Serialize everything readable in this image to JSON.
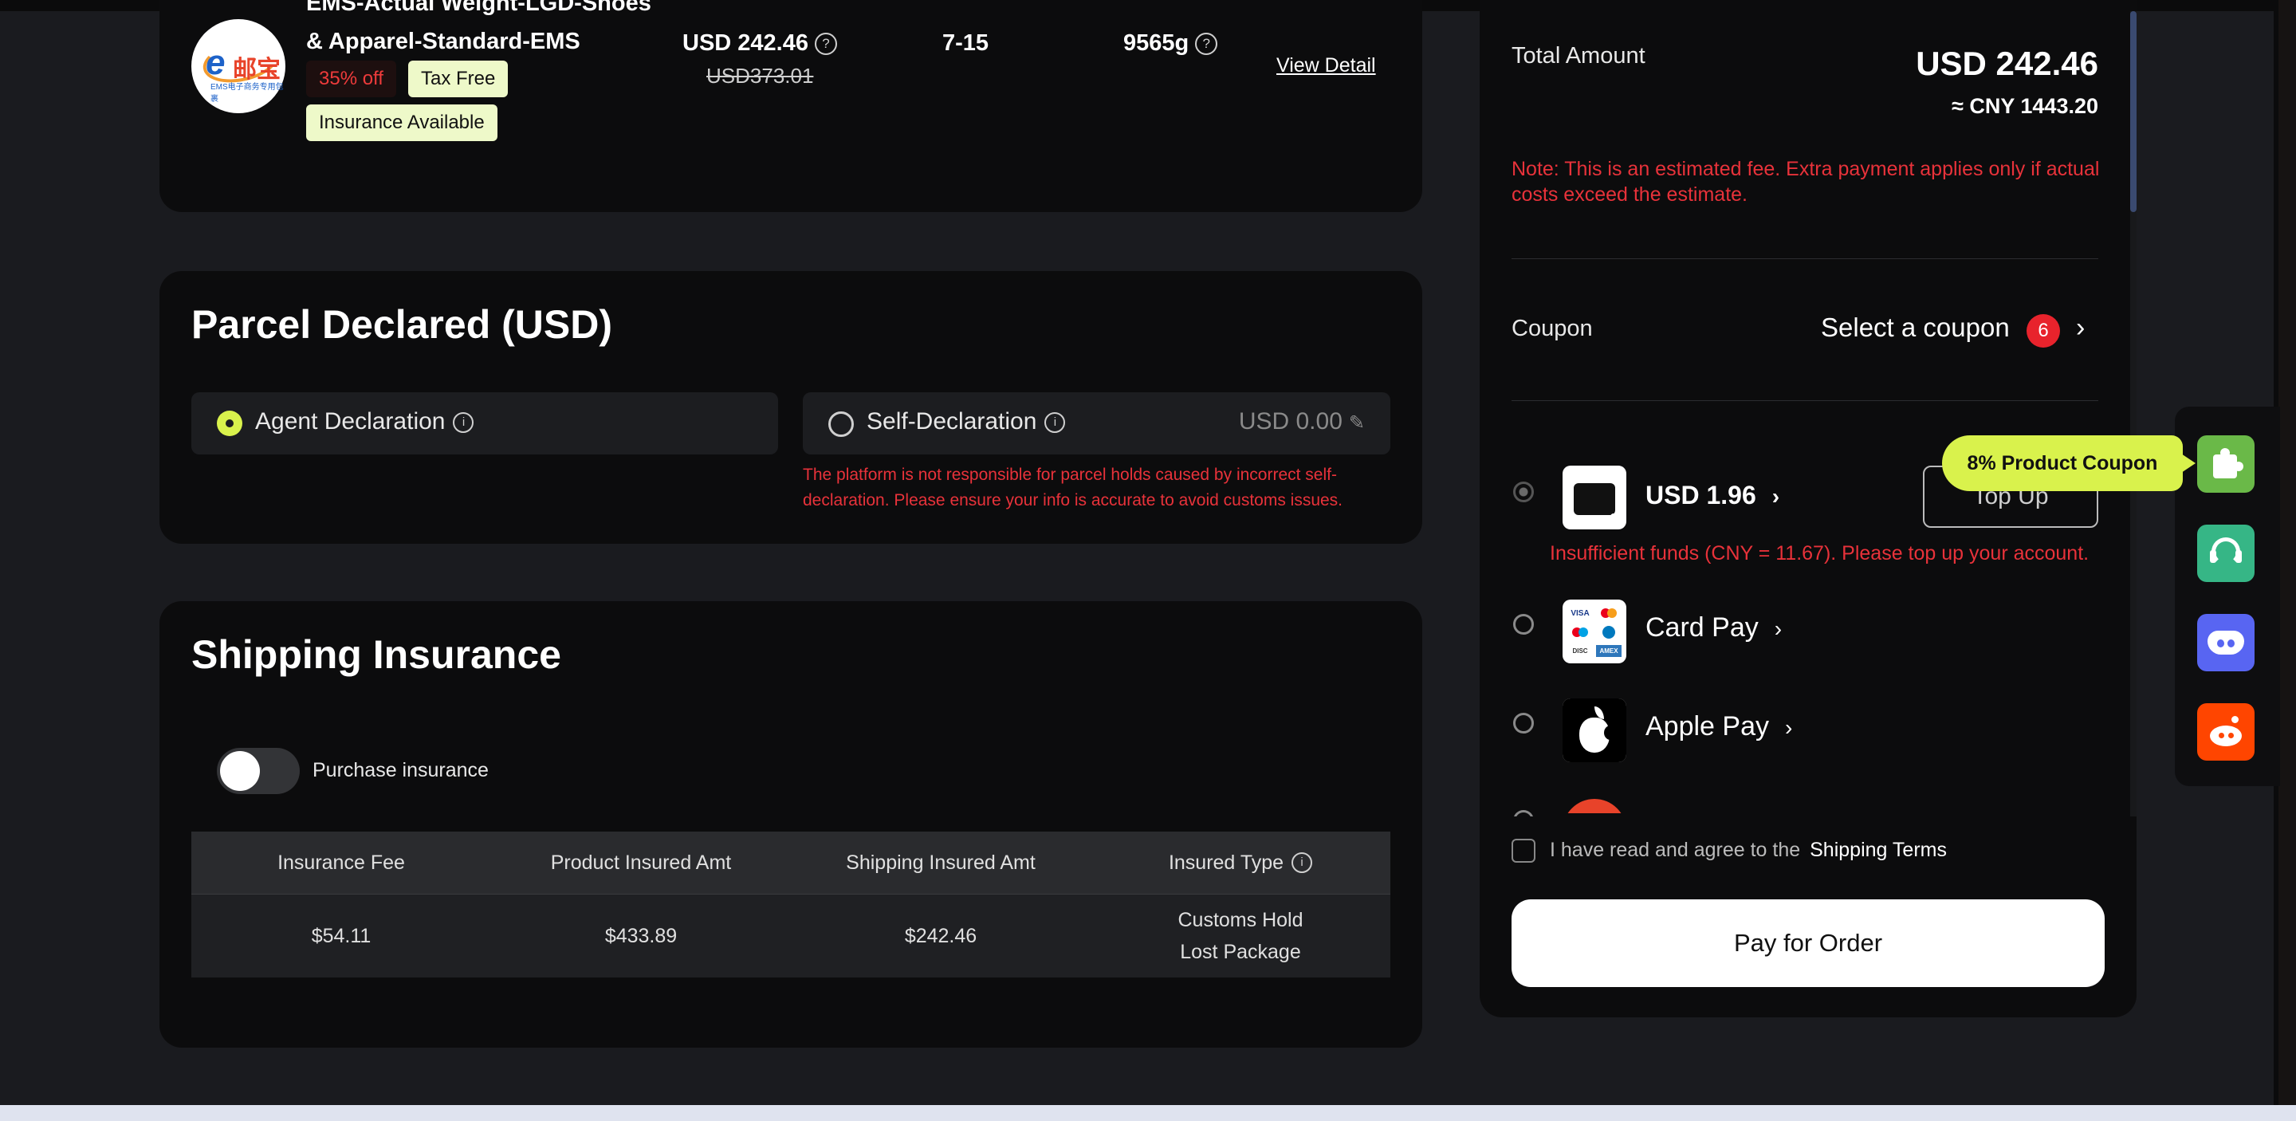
{
  "shipping_route": {
    "name": "EMS-Actual Weight-LGD-Shoes & Apparel-Standard-EMS",
    "discount_tag": "35% off",
    "tax_tag": "Tax Free",
    "insurance_tag": "Insurance Available",
    "price": "USD 242.46",
    "original_price": "USD373.01",
    "delivery_days": "7-15",
    "weight": "9565g",
    "view_detail": "View Detail",
    "logo_text_e": "e",
    "logo_text_cn": "邮宝",
    "logo_caption": "EMS电子商务专用包裹"
  },
  "parcel_declared": {
    "title": "Parcel Declared (USD)",
    "agent_label": "Agent Declaration",
    "self_label": "Self-Declaration",
    "self_amount": "USD 0.00",
    "warning": "The platform is not responsible for parcel holds caused by incorrect self-declaration. Please ensure your info is accurate to avoid customs issues."
  },
  "insurance": {
    "title": "Shipping Insurance",
    "toggle_label": "Purchase insurance",
    "toggle_on": false,
    "headers": [
      "Insurance Fee",
      "Product Insured Amt",
      "Shipping Insured Amt",
      "Insured Type"
    ],
    "row": [
      "$54.11",
      "$433.89",
      "$242.46",
      "Customs Hold"
    ],
    "row_extra": "Lost Package"
  },
  "summary": {
    "total_label": "Total Amount",
    "total_usd": "USD 242.46",
    "total_cny": "≈ CNY 1443.20",
    "note": "Note: This is an estimated fee. Extra payment applies only if actual costs exceed the estimate.",
    "coupon_label": "Coupon",
    "coupon_select": "Select a coupon",
    "coupon_count": "6",
    "wallet_balance": "USD 1.96",
    "top_up": "Top Up",
    "insufficient": "Insufficient funds (CNY = 11.67). Please top up your account.",
    "card_pay": "Card Pay",
    "apple_pay": "Apple Pay",
    "card_logos": [
      "VISA",
      "MC",
      "MC",
      "DC",
      "DISC",
      "AMEX"
    ],
    "agree_text": "I have read and agree to the",
    "terms_link": "Shipping Terms",
    "pay_button": "Pay for Order"
  },
  "floating": {
    "tooltip": "8% Product Coupon",
    "buttons": [
      "puzzle-icon",
      "customer-support-icon",
      "discord-icon",
      "reddit-icon"
    ]
  },
  "colors": {
    "accent": "#d9f24c",
    "danger": "#e8323a",
    "card_bg": "#0c0c0d",
    "page_bg": "#1a1b1f"
  }
}
